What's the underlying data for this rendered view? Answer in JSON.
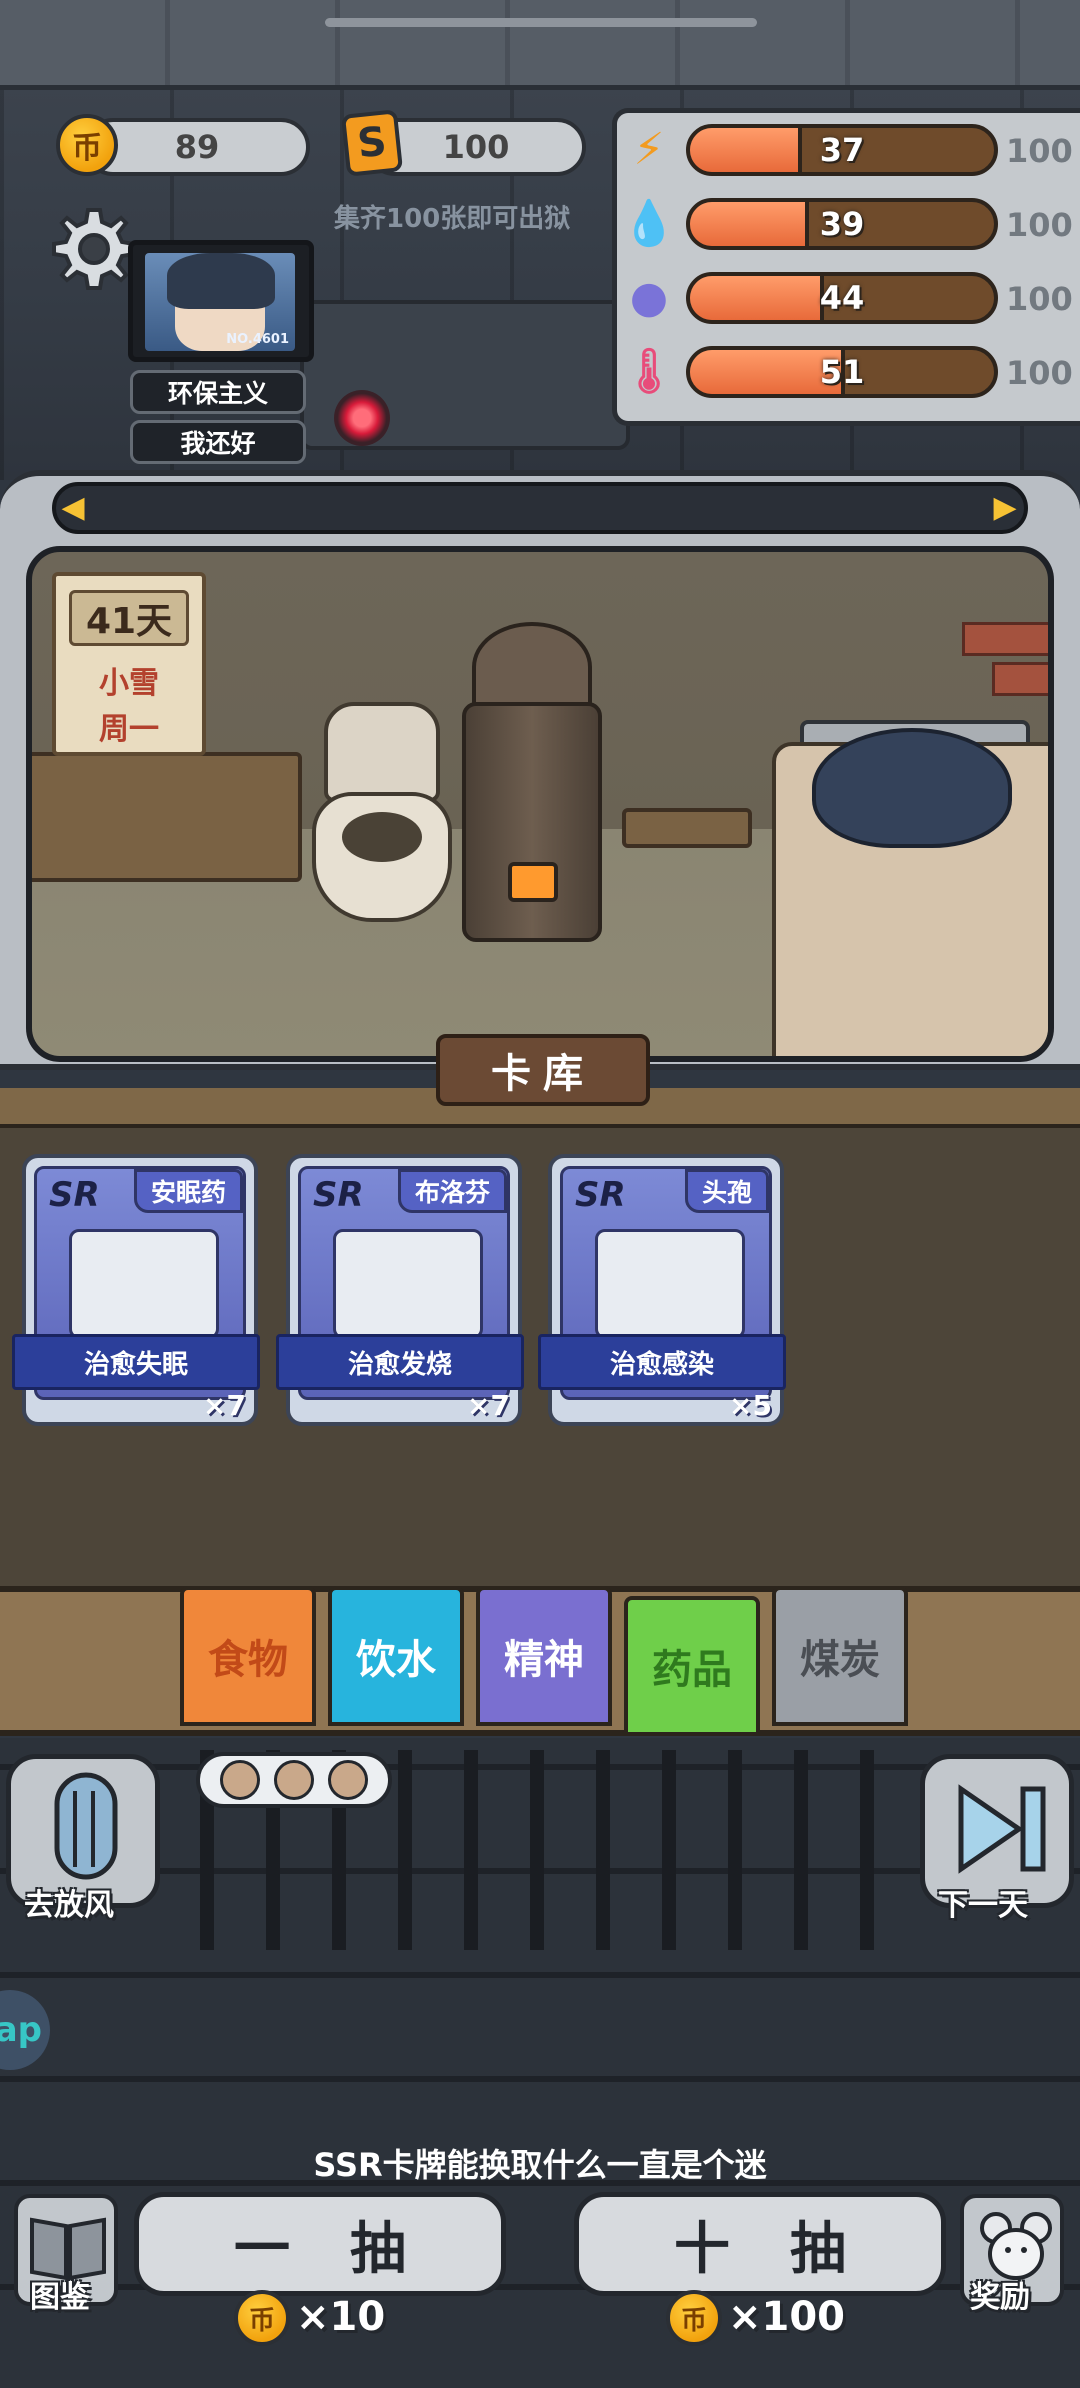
{
  "currency": {
    "coin_symbol": "币",
    "coins": "89",
    "s_symbol": "S",
    "s_cards": "100",
    "hint": "集齐100张即可出狱"
  },
  "profile": {
    "monitor_no": "NO.4601",
    "trait": "环保主义",
    "mood": "我还好"
  },
  "stats": [
    {
      "icon": "lightning-icon",
      "glyph": "⚡",
      "value": 37,
      "max": "100",
      "color": "#f39b1f"
    },
    {
      "icon": "water-drop-icon",
      "glyph": "💧",
      "value": 39,
      "max": "100",
      "color": "#3aa6e8"
    },
    {
      "icon": "brain-icon",
      "glyph": "●",
      "value": 44,
      "max": "100",
      "color": "#7a73d8"
    },
    {
      "icon": "thermometer-icon",
      "glyph": "🌡",
      "value": 51,
      "max": "100",
      "color": "#e84c7a"
    }
  ],
  "scene": {
    "day": "41天",
    "weather": "小雪",
    "weekday": "周一"
  },
  "vault_title": "卡库",
  "cards": [
    {
      "rank": "SR",
      "name": "安眠药",
      "effect": "治愈失眠",
      "count": "×7"
    },
    {
      "rank": "SR",
      "name": "布洛芬",
      "effect": "治愈发烧",
      "count": "×7"
    },
    {
      "rank": "SR",
      "name": "头孢",
      "effect": "治愈感染",
      "count": "×5"
    }
  ],
  "categories": [
    {
      "label": "食物",
      "bg": "#f0873a",
      "fg": "#c24a18"
    },
    {
      "label": "饮水",
      "bg": "#27b4dd",
      "fg": "#ffffff"
    },
    {
      "label": "精神",
      "bg": "#7a6fd0",
      "fg": "#ffffff"
    },
    {
      "label": "药品",
      "bg": "#6fcf4a",
      "fg": "#2f7a1e"
    },
    {
      "label": "煤炭",
      "bg": "#9a9fa6",
      "fg": "#4a4e54"
    }
  ],
  "actions": {
    "go_out": "去放风",
    "next_day": "下一天",
    "tip": "SSR卡牌能换取什么一直是个迷",
    "gallery": "图鉴",
    "reward": "奖励",
    "draw_one": "一抽",
    "draw_one_cost": "×10",
    "draw_ten": "十抽",
    "draw_ten_cost": "×100",
    "app_badge": "ap"
  }
}
